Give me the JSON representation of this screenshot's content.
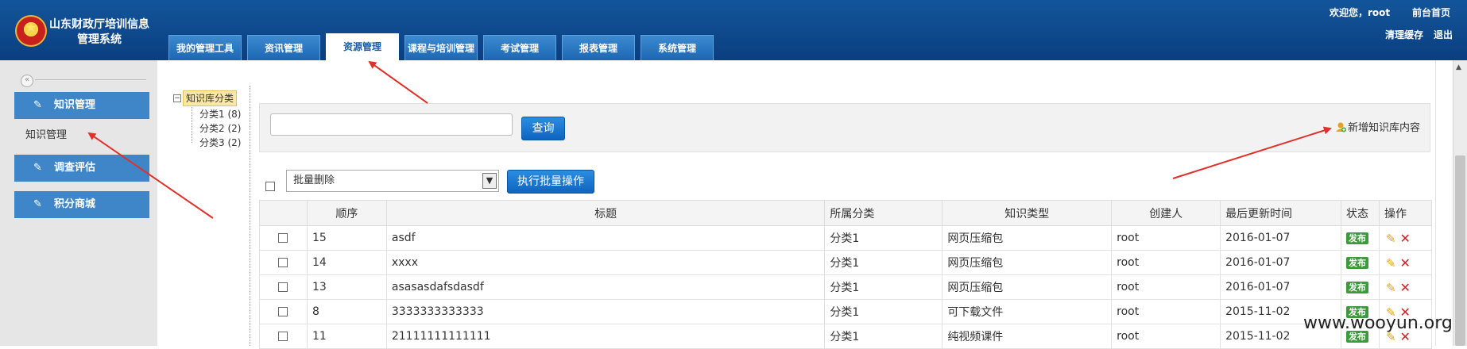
{
  "header": {
    "system_title_line1": "山东财政厅培训信息",
    "system_title_line2": "管理系统",
    "welcome": "欢迎您，root",
    "front_home": "前台首页",
    "clear_cache": "清理缓存",
    "logout": "退出",
    "tabs": [
      {
        "label": "我的管理工具",
        "active": false
      },
      {
        "label": "资讯管理",
        "active": false
      },
      {
        "label": "资源管理",
        "active": true
      },
      {
        "label": "课程与培训管理",
        "active": false
      },
      {
        "label": "考试管理",
        "active": false
      },
      {
        "label": "报表管理",
        "active": false
      },
      {
        "label": "系统管理",
        "active": false
      }
    ]
  },
  "sidebar": {
    "collapse_symbol": "«",
    "items": [
      {
        "label": "知识管理",
        "icon": "pencil-icon"
      },
      {
        "label": "调查评估",
        "icon": "pencil-icon"
      },
      {
        "label": "积分商城",
        "icon": "pencil-icon"
      }
    ],
    "subitem": "知识管理"
  },
  "tree": {
    "toggle": "−",
    "root": "知识库分类",
    "children": [
      "分类1 (8)",
      "分类2 (2)",
      "分类3 (2)"
    ]
  },
  "search": {
    "value": "",
    "button": "查询",
    "add_link": "新增知识库内容"
  },
  "bulk": {
    "selected": "批量删除",
    "button": "执行批量操作"
  },
  "table": {
    "columns": [
      "顺序",
      "标题",
      "所属分类",
      "知识类型",
      "创建人",
      "最后更新时间",
      "状态",
      "操作"
    ],
    "rows": [
      {
        "order": "15",
        "title": "asdf",
        "category": "分类1",
        "type": "网页压缩包",
        "creator": "root",
        "updated": "2016-01-07",
        "status": "发布"
      },
      {
        "order": "14",
        "title": "xxxx",
        "category": "分类1",
        "type": "网页压缩包",
        "creator": "root",
        "updated": "2016-01-07",
        "status": "发布"
      },
      {
        "order": "13",
        "title": "asasasdafsdasdf",
        "category": "分类1",
        "type": "网页压缩包",
        "creator": "root",
        "updated": "2016-01-07",
        "status": "发布"
      },
      {
        "order": "8",
        "title": "3333333333333",
        "category": "分类1",
        "type": "可下载文件",
        "creator": "root",
        "updated": "2015-11-02",
        "status": "发布"
      },
      {
        "order": "11",
        "title": "21111111111111",
        "category": "分类1",
        "type": "纯视频课件",
        "creator": "root",
        "updated": "2015-11-02",
        "status": "发布"
      }
    ]
  },
  "watermark": "www.wooyun.org",
  "colors": {
    "header": "#0e4b8f",
    "tab": "#2a78c4",
    "sidebar_button": "#3e86c8",
    "badge": "#3c9a3c",
    "arrow": "#e0302a"
  }
}
